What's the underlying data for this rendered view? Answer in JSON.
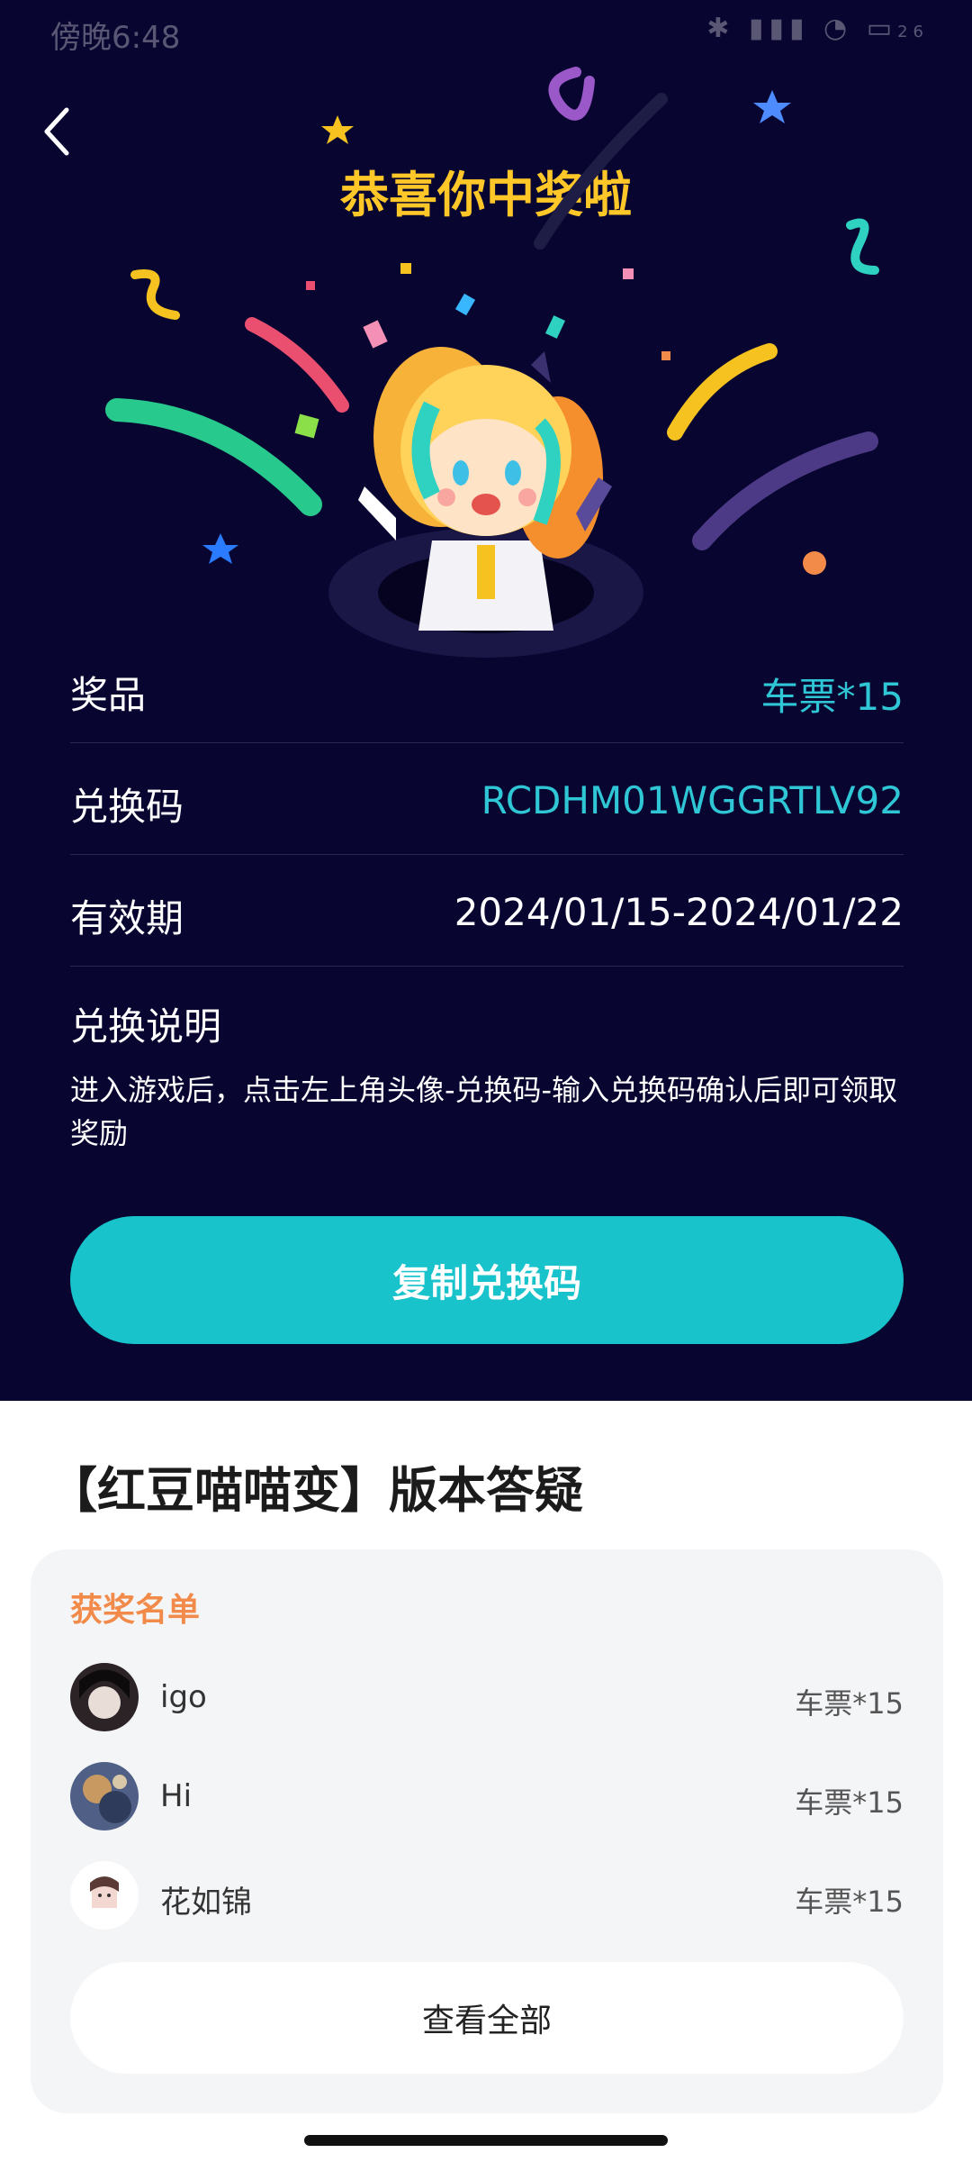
{
  "status_bar": {
    "time": "傍晚6:48",
    "right_icons": [
      "bluetooth-icon",
      "signal-icon",
      "wifi-icon",
      "battery-icon"
    ],
    "battery": "26"
  },
  "header": {
    "title": "恭喜你中奖啦"
  },
  "details": [
    {
      "label": "奖品",
      "value": "车票*15"
    },
    {
      "label": "兑换码",
      "value": "RCDHM01WGGRTLV92"
    },
    {
      "label": "有效期",
      "value": "2024/01/15-2024/01/22"
    }
  ],
  "instructions": {
    "title": "兑换说明",
    "text": "进入游戏后，点击左上角头像-兑换码-输入兑换码确认后即可领取奖励"
  },
  "copy_button": "复制兑换码",
  "section_title": "【红豆喵喵变】版本答疑",
  "winners": {
    "title": "获奖名单",
    "items": [
      {
        "name": "igo",
        "prize": "车票*15"
      },
      {
        "name": "Hi",
        "prize": "车票*15"
      },
      {
        "name": "花如锦",
        "prize": "车票*15"
      }
    ],
    "view_all": "查看全部"
  },
  "colors": {
    "hero_bg": "#080530",
    "title": "#ffc727",
    "accent": "#18c3cb",
    "winners_title": "#f28a4a"
  }
}
